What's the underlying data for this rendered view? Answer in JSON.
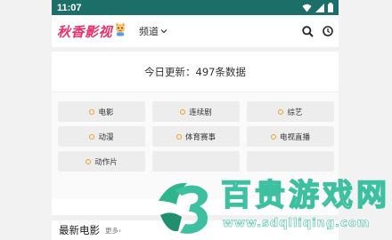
{
  "status_bar": {
    "time": "11:07"
  },
  "header": {
    "logo_text": "秋香影视",
    "channel_label": "频道"
  },
  "update_notice": "今日更新：497条数据",
  "categories": [
    {
      "label": "电影"
    },
    {
      "label": "连续剧"
    },
    {
      "label": "综艺"
    },
    {
      "label": "动漫"
    },
    {
      "label": "体育赛事"
    },
    {
      "label": "电视直播"
    },
    {
      "label": "动作片"
    }
  ],
  "section": {
    "title": "最新电影",
    "more": "更多›"
  },
  "watermark": {
    "brand": "百贵游戏网",
    "url": "www.sdqlliqing.com"
  },
  "colors": {
    "status_bar": "#1c6e68",
    "logo": "#e8336a",
    "category_dot": "#f0a020",
    "watermark_accent": "#3cc0a0"
  }
}
